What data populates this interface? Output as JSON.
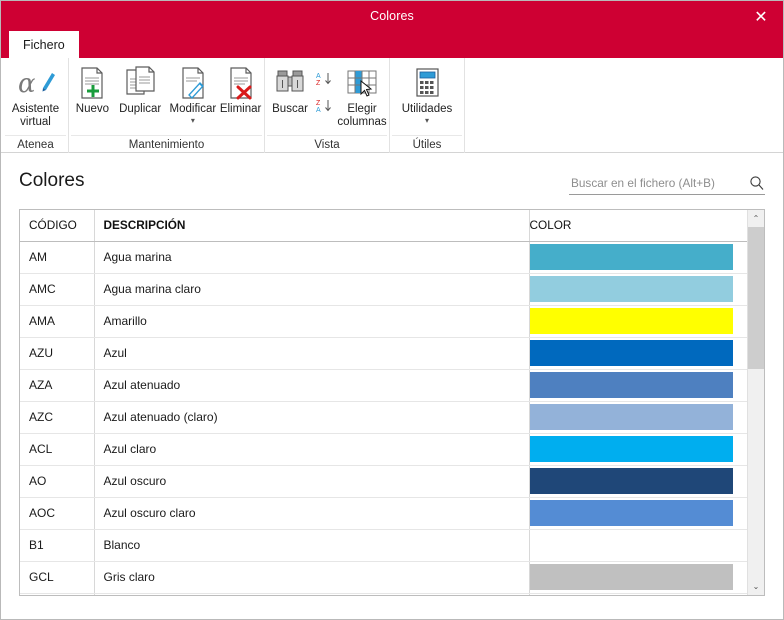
{
  "window": {
    "title": "Colores",
    "close_label": "✕",
    "titlebar_color": "#CE0033"
  },
  "tabs": [
    {
      "label": "Fichero",
      "name": "tab-fichero",
      "active": true
    }
  ],
  "ribbon": {
    "groups": [
      {
        "label": "Atenea",
        "buttons": [
          {
            "label": "Asistente virtual",
            "icon": "alpha-pen-icon"
          }
        ]
      },
      {
        "label": "Mantenimiento",
        "buttons": [
          {
            "label": "Nuevo",
            "icon": "new-document-icon"
          },
          {
            "label": "Duplicar",
            "icon": "duplicate-document-icon"
          },
          {
            "label": "Modificar",
            "icon": "edit-document-icon",
            "caret": "▾"
          },
          {
            "label": "Eliminar",
            "icon": "delete-document-icon"
          }
        ]
      },
      {
        "label": "Vista",
        "buttons": [
          {
            "label": "Buscar",
            "icon": "binoculars-icon"
          },
          {
            "label": "Elegir columnas",
            "icon": "choose-columns-icon"
          }
        ],
        "sorts": [
          {
            "label": "sort-ascending",
            "icon": "sort-az-icon"
          },
          {
            "label": "sort-descending",
            "icon": "sort-za-icon"
          }
        ]
      },
      {
        "label": "Útiles",
        "buttons": [
          {
            "label": "Utilidades",
            "icon": "calculator-icon",
            "caret": "▾"
          }
        ]
      }
    ]
  },
  "page": {
    "title": "Colores"
  },
  "search": {
    "placeholder": "Buscar en el fichero (Alt+B)",
    "value": ""
  },
  "table": {
    "columns": [
      {
        "key": "codigo",
        "label": "CÓDIGO"
      },
      {
        "key": "descripcion",
        "label": "DESCRIPCIÓN"
      },
      {
        "key": "color",
        "label": "COLOR"
      }
    ],
    "rows": [
      {
        "codigo": "AM",
        "descripcion": "Agua marina",
        "color": "#45AECA"
      },
      {
        "codigo": "AMC",
        "descripcion": "Agua marina claro",
        "color": "#92CDDF"
      },
      {
        "codigo": "AMA",
        "descripcion": "Amarillo",
        "color": "#FFFF00"
      },
      {
        "codigo": "AZU",
        "descripcion": "Azul",
        "color": "#0069BE"
      },
      {
        "codigo": "AZA",
        "descripcion": "Azul atenuado",
        "color": "#4E80C0"
      },
      {
        "codigo": "AZC",
        "descripcion": "Azul atenuado (claro)",
        "color": "#93B2D9"
      },
      {
        "codigo": "ACL",
        "descripcion": "Azul claro",
        "color": "#00AEEF"
      },
      {
        "codigo": "AO",
        "descripcion": "Azul oscuro",
        "color": "#1F4778"
      },
      {
        "codigo": "AOC",
        "descripcion": "Azul oscuro claro",
        "color": "#548CD4"
      },
      {
        "codigo": "B1",
        "descripcion": "Blanco",
        "color": "#FFFFFF"
      },
      {
        "codigo": "GCL",
        "descripcion": "Gris claro",
        "color": "#C0C0C0"
      },
      {
        "codigo": "",
        "descripcion": "",
        "color": "#404040"
      }
    ]
  },
  "scrollbar": {
    "up_arrow": "⌃",
    "down_arrow": "⌄"
  }
}
